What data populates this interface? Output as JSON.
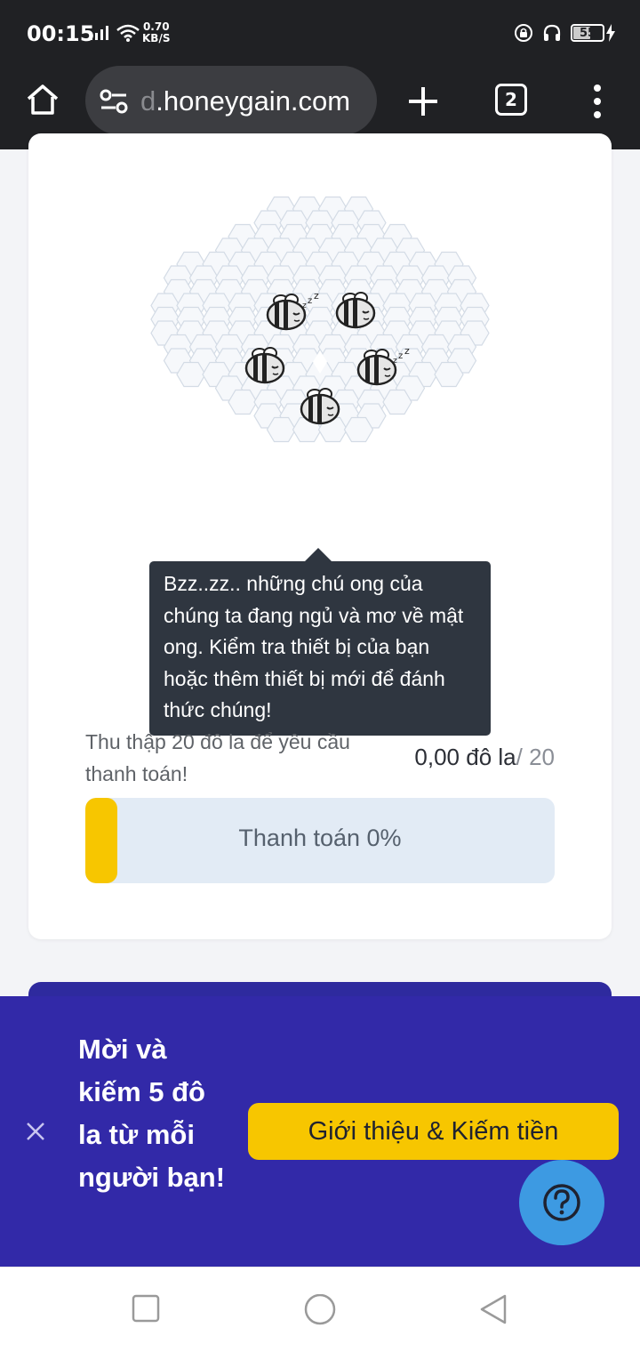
{
  "status_bar": {
    "time": "00:15",
    "net_speed_value": "0.70",
    "net_speed_unit": "KB/S",
    "battery_level": "55"
  },
  "browser": {
    "url_faded_prefix": "d",
    "url_domain": ".honeygain.com",
    "tab_count": "2"
  },
  "card": {
    "tooltip_text": "Bzz..zz.. những chú ong của chúng ta đang ngủ và mơ về mật ong. Kiểm tra thiết bị của bạn hoặc thêm thiết bị mới để đánh thức chúng!",
    "collect_text": "Thu thập 20 đô la để yêu cầu thanh toán!",
    "balance_value": "0,00 đô la",
    "balance_target": "/ 20",
    "progress_label": "Thanh toán 0%",
    "progress_fraction": 0
  },
  "banner": {
    "text": "Mời và kiếm 5 đô la từ mỗi người bạn!",
    "refer_button": "Giới thiệu & Kiếm tiền"
  },
  "icons": {
    "home": "home-icon",
    "site_settings": "tune-icon",
    "new_tab": "plus-icon",
    "menu": "more-vert-icon",
    "close": "close-icon",
    "help": "question-icon",
    "bee": "sleeping-bee-icon",
    "recents": "square-icon",
    "home_nav": "circle-icon",
    "back": "triangle-back-icon"
  },
  "colors": {
    "accent_yellow": "#f7c600",
    "banner_purple": "#3229a8",
    "help_blue": "#3d9ae2",
    "tooltip_dark": "#2f3640"
  }
}
